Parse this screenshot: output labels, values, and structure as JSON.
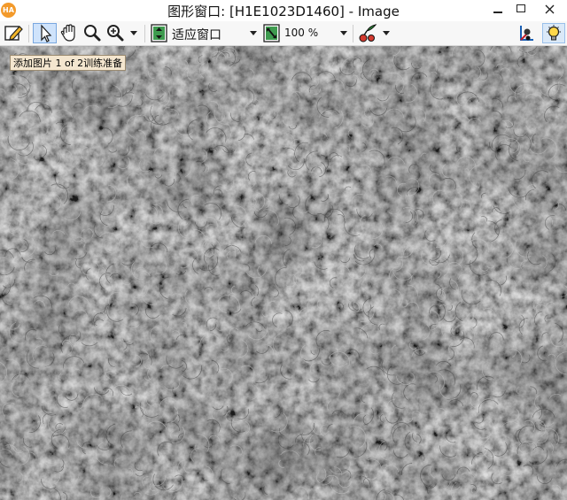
{
  "window": {
    "title": "图形窗口: [H1E1023D1460] - Image",
    "app_icon_text": "HA"
  },
  "toolbar": {
    "zoom_mode": "适应窗口",
    "zoom_percent": "100 %"
  },
  "image": {
    "caption": "添加图片 1 of 2训练准备",
    "description_colors": {
      "base": "#7b7b7b",
      "dark_fiber": "#3a3a3a",
      "light_fiber": "#c8c8c8"
    }
  }
}
